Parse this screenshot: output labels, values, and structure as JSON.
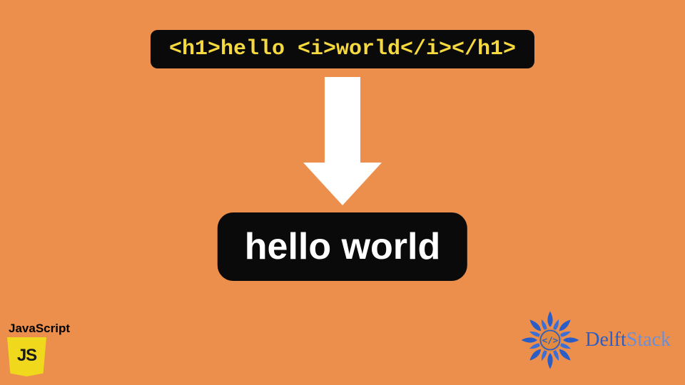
{
  "code_box": {
    "raw_html": "<h1>hello <i>world</i></h1>"
  },
  "output_box": {
    "text": "hello world"
  },
  "js_logo": {
    "label": "JavaScript",
    "badge_text": "JS"
  },
  "delft_logo": {
    "brand_part1": "Delft",
    "brand_part2": "Stack"
  },
  "colors": {
    "background": "#ed8f4c",
    "code_bg": "#0a0a0a",
    "code_text": "#f5d93f",
    "arrow": "#ffffff",
    "output_text": "#ffffff",
    "js_yellow": "#f0d91d",
    "delft_blue": "#2a5dc5"
  }
}
